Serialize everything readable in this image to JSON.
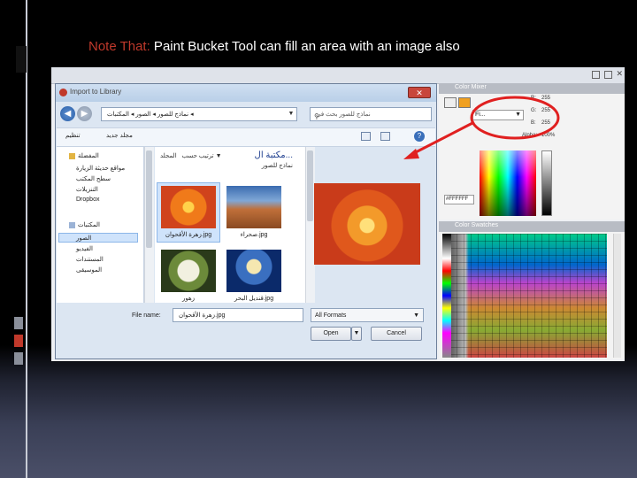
{
  "slide": {
    "title_highlight": "Note That:",
    "title_rest": " Paint Bucket Tool can fill an area with an image also",
    "accent_color": "#c0392b"
  },
  "dialog": {
    "title": "Import to Library",
    "close_icon": "close-icon",
    "address_path": "نماذج للصور ◂ الصور ◂ المكتبات ◂",
    "search_placeholder": "نماذج للصور بحث في",
    "toolbar": {
      "organize": "تنظيم",
      "new_folder": "مجلد جديد",
      "arrange_by": "المجلد",
      "arrange_label": "ترتيب حسب"
    },
    "nav": {
      "favorites_header": "المفضلة",
      "favorites": [
        "مواقع حديثة الزيارة",
        "سطح المكتب",
        "التنزيلات",
        "Dropbox"
      ],
      "libraries_header": "المكتبات",
      "libraries": [
        "الصور",
        "الفيديو",
        "المستندات",
        "الموسيقى"
      ]
    },
    "library_title": "مكتبة ال...",
    "library_subtitle": "نماذج للصور",
    "files": [
      {
        "name": "زهرة الأقحوان.jpg",
        "selected": true
      },
      {
        "name": "صحراء.jpg",
        "selected": false
      },
      {
        "name": "زهور",
        "selected": false
      },
      {
        "name": "قنديل البحر.jpg",
        "selected": false
      }
    ],
    "file_name_label": "File name:",
    "file_name_value": "زهرة الأقحوان.jpg",
    "format_value": "All Formats",
    "open_label": "Open",
    "cancel_label": "Cancel"
  },
  "color_mixer": {
    "title": "Color Mixer",
    "fill_type": "Fi...",
    "r_label": "R:",
    "r_value": "255",
    "g_label": "G:",
    "g_value": "255",
    "b_label": "B:",
    "b_value": "255",
    "alpha_label": "Alpha:",
    "alpha_value": "100%",
    "hex_value": "#FFFFFF"
  },
  "color_swatches": {
    "title": "Color Swatches"
  }
}
